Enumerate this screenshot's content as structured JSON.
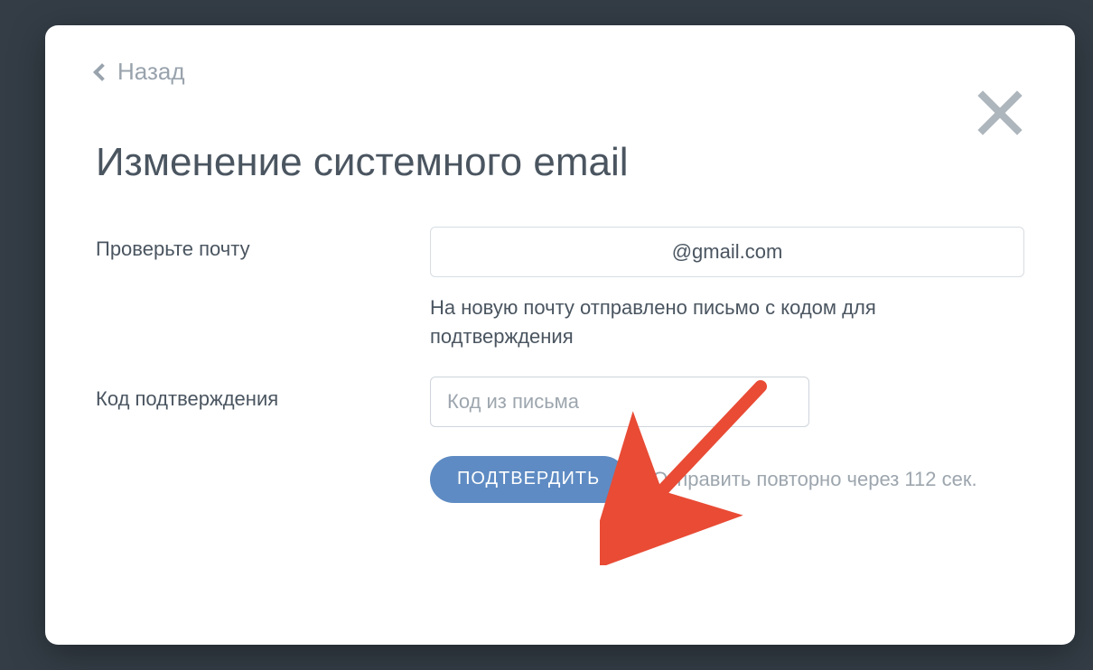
{
  "back_label": "Назад",
  "title": "Изменение системного email",
  "email_label": "Проверьте почту",
  "email_value": "@gmail.com",
  "email_help": "На новую почту отправлено письмо с кодом для подтверждения",
  "code_label": "Код подтверждения",
  "code_placeholder": "Код из письма",
  "confirm_label": "ПОДТВЕРДИТЬ",
  "resend_label": "Отправить повторно через 112 сек."
}
